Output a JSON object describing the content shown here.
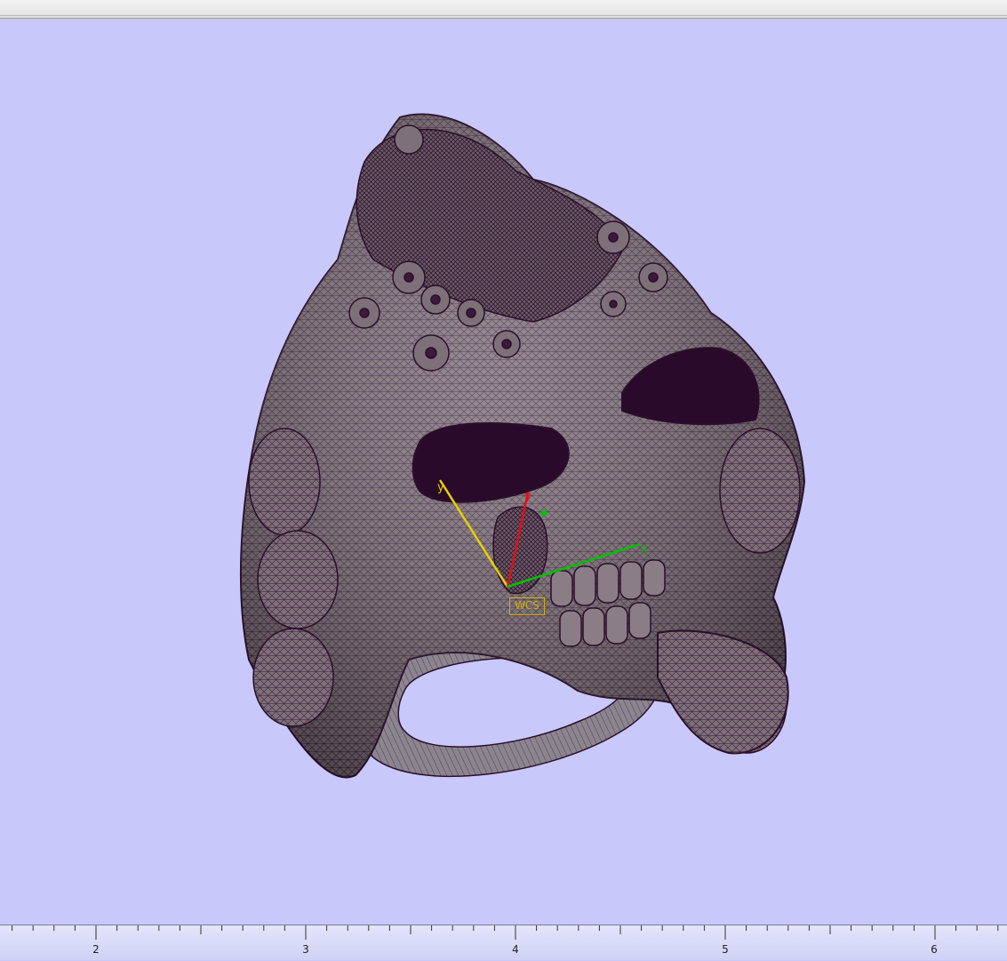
{
  "viewport": {
    "background": "#c8c8fb",
    "model_color": "#7d7078",
    "mesh_color": "#3c1a3c",
    "model_icon": "3d-mesh-ring-model"
  },
  "axes": {
    "wcs_label": "WCS",
    "x_label": "x",
    "y_label": "y",
    "z_label": "y",
    "x_color": "#00c000",
    "y_color": "#e6d000",
    "z_color": "#e01010",
    "label_color": "#d4b000"
  },
  "ruler": {
    "labels": [
      "2",
      "3",
      "4",
      "5",
      "6"
    ]
  }
}
